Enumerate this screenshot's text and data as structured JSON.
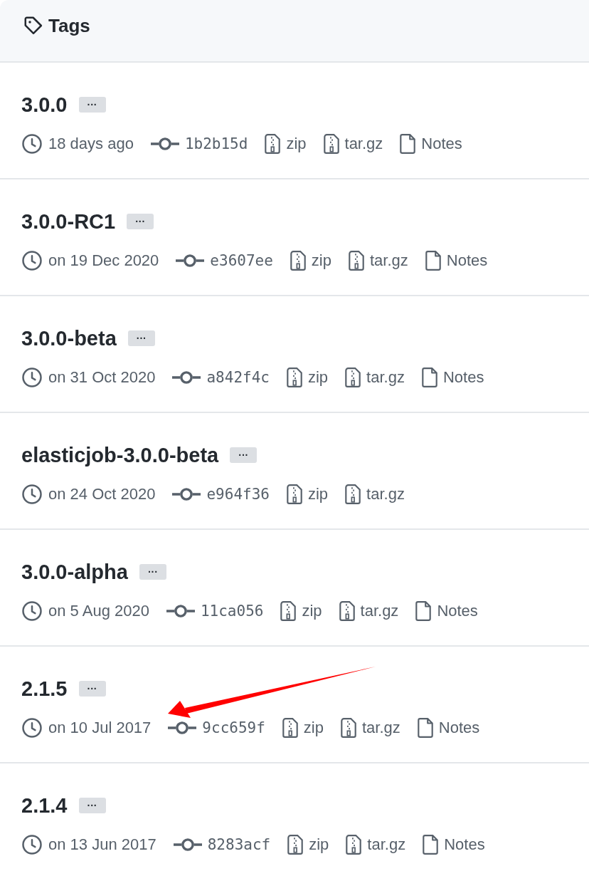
{
  "header": {
    "title": "Tags"
  },
  "tags": [
    {
      "name": "3.0.0",
      "more": "···",
      "date": "18 days ago",
      "commit": "1b2b15d",
      "zip": "zip",
      "tar": "tar.gz",
      "notes": "Notes"
    },
    {
      "name": "3.0.0-RC1",
      "more": "···",
      "date": "on 19 Dec 2020",
      "commit": "e3607ee",
      "zip": "zip",
      "tar": "tar.gz",
      "notes": "Notes"
    },
    {
      "name": "3.0.0-beta",
      "more": "···",
      "date": "on 31 Oct 2020",
      "commit": "a842f4c",
      "zip": "zip",
      "tar": "tar.gz",
      "notes": "Notes"
    },
    {
      "name": "elasticjob-3.0.0-beta",
      "more": "···",
      "date": "on 24 Oct 2020",
      "commit": "e964f36",
      "zip": "zip",
      "tar": "tar.gz"
    },
    {
      "name": "3.0.0-alpha",
      "more": "···",
      "date": "on 5 Aug 2020",
      "commit": "11ca056",
      "zip": "zip",
      "tar": "tar.gz",
      "notes": "Notes"
    },
    {
      "name": "2.1.5",
      "more": "···",
      "date": "on 10 Jul 2017",
      "commit": "9cc659f",
      "zip": "zip",
      "tar": "tar.gz",
      "notes": "Notes"
    },
    {
      "name": "2.1.4",
      "more": "···",
      "date": "on 13 Jun 2017",
      "commit": "8283acf",
      "zip": "zip",
      "tar": "tar.gz",
      "notes": "Notes"
    }
  ],
  "annotation": {
    "kind": "arrow"
  }
}
